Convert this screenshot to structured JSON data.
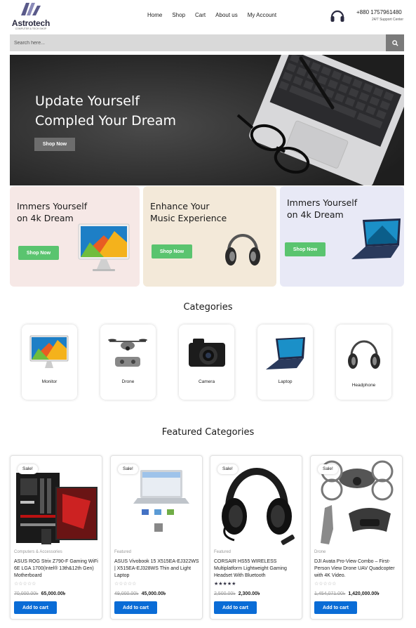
{
  "brand": {
    "name": "Astrotech",
    "tagline": "COMPUTER & TECH SHOP"
  },
  "nav": [
    "Home",
    "Shop",
    "Cart",
    "About us",
    "My Account"
  ],
  "support": {
    "phone": "+880 1757961480",
    "label": "24/7 Support Center"
  },
  "search": {
    "placeholder": "Search here..."
  },
  "hero": {
    "title_line1": "Update Yourself",
    "title_line2": "Compled Your Dream",
    "button": "Shop Now"
  },
  "promos": [
    {
      "title": "Immers Yourself\non 4k Dream",
      "button": "Shop Now",
      "bg": "#f6e8e6"
    },
    {
      "title": "Enhance Your\nMusic Experience",
      "button": "Shop Now",
      "bg": "#f3e9d9"
    },
    {
      "title": "Immers Yourself\non 4k Dream",
      "button": "Shop Now",
      "bg": "#e8e9f6"
    }
  ],
  "categories_title": "Categories",
  "categories": [
    "Monitor",
    "Drone",
    "Camera",
    "Laptop",
    "Headphone"
  ],
  "featured_title": "Featured Categories",
  "products": [
    {
      "badge": "Sale!",
      "category": "Computers & Accessories",
      "name": "ASUS ROG Strix Z790-F Gaming WiFi 6E LGA 1700(Intel® 13th&12th Gen) Motherboard",
      "rating": "☆☆☆☆☆",
      "old_price": "70,000.00৳",
      "new_price": "65,000.00৳",
      "button": "Add to cart"
    },
    {
      "badge": "Sale!",
      "category": "Featured",
      "name": "ASUS Vivobook 15 X515EA-EJ322WS | X515EA-EJ328WS Thin and Light Laptop",
      "rating": "☆☆☆☆☆",
      "old_price": "49,000.00৳",
      "new_price": "45,000.00৳",
      "button": "Add to cart"
    },
    {
      "badge": "Sale!",
      "category": "Featured",
      "name": "CORSAIR HS55 WIRELESS Multiplatform Lightweight Gaming Headset With Bluetooth",
      "rating": "★★★★★",
      "old_price": "2,500.00৳",
      "new_price": "2,300.00৳",
      "button": "Add to cart"
    },
    {
      "badge": "Sale!",
      "category": "Drone",
      "name": "DJI Avata Pro-View Combo – First-Person View Drone UAV Quadcopter with 4K Video.",
      "rating": "☆☆☆☆☆",
      "old_price": "1,454,071.00৳",
      "new_price": "1,420,000.00৳",
      "button": "Add to cart"
    }
  ],
  "colors": {
    "green_button": "#5ac46f",
    "blue_button": "#0a6cd6",
    "search_bg": "#d9d9d9"
  }
}
